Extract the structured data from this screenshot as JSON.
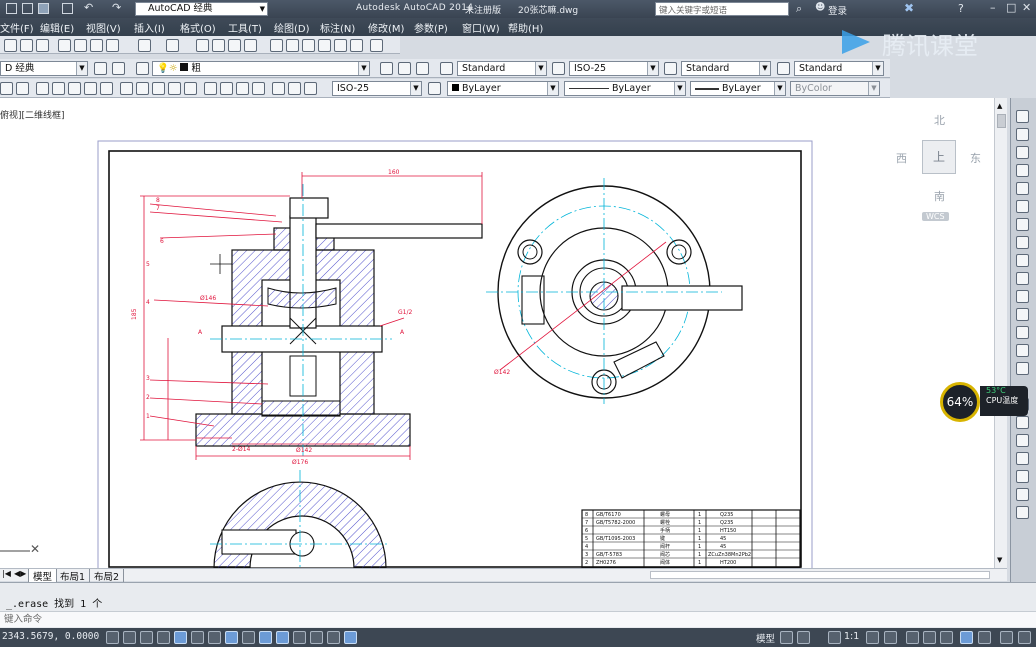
{
  "titlebar": {
    "workspace_combo": "AutoCAD 经典",
    "app_title": "Autodesk AutoCAD 2014",
    "document_title": "未注册版",
    "file_name": "20张芯嘛.dwg",
    "search_placeholder": "键入关键字或短语",
    "login_label": "登录"
  },
  "menubar": {
    "items": [
      "文件(F)",
      "编辑(E)",
      "视图(V)",
      "插入(I)",
      "格式(O)",
      "工具(T)",
      "绘图(D)",
      "标注(N)",
      "修改(M)",
      "参数(P)",
      "窗口(W)",
      "帮助(H)"
    ]
  },
  "watermark": {
    "text": "腾讯课堂"
  },
  "styles_toolbar": {
    "workspace": "D 经典",
    "text_style": "Standard",
    "dim_style": "ISO-25",
    "table_style": "Standard",
    "multileader_style": "Standard"
  },
  "properties_toolbar": {
    "dim_style": "ISO-25",
    "color": "ByLayer",
    "linetype": "ByLayer",
    "lineweight": "ByLayer",
    "plotstyle": "ByColor"
  },
  "viewport_label": "俯视][二维线框]",
  "viewcube": {
    "north": "北",
    "south": "南",
    "east": "东",
    "west": "西",
    "top": "上",
    "wcs": "WCS"
  },
  "drawing": {
    "dim_top": "160",
    "dim_left_height": "185",
    "dim_width_bottom": "Ø176",
    "dim_inner": "Ø142",
    "dim_base": "Ø146",
    "dim_small": "2-Ø14",
    "thread_label": "G1/2",
    "callouts": [
      "8",
      "7",
      "6",
      "5",
      "4",
      "3",
      "2",
      "1"
    ],
    "section_label_a": "A",
    "circle_dim": "Ø142"
  },
  "title_block": {
    "rows": [
      [
        "8",
        "GB/T6170",
        "螺母",
        "1",
        "Q235"
      ],
      [
        "7",
        "GB/T5782-2000",
        "螺栓",
        "1",
        "Q235"
      ],
      [
        "6",
        "",
        "手柄",
        "1",
        "HT150"
      ],
      [
        "5",
        "GB/T1095-2003",
        "键",
        "1",
        "45"
      ],
      [
        "4",
        "",
        "阀杆",
        "1",
        "45"
      ],
      [
        "3",
        "GB/T-5783",
        "阀芯",
        "1",
        "ZCuZn38Mn2Pb2"
      ],
      [
        "2",
        "ZH0276",
        "阀体",
        "1",
        "HT200"
      ]
    ]
  },
  "tabs": {
    "model": "模型",
    "layout1": "布局1",
    "layout2": "布局2"
  },
  "command": {
    "history": "_.erase 找到 1 个",
    "prompt": "键入命令"
  },
  "status": {
    "coords": "2343.5679, 0.0000",
    "model_label": "模型",
    "scale": "1:1"
  },
  "cpu_widget": {
    "percent": "64%",
    "temp": "53°C",
    "label": "CPU温度"
  },
  "colors": {
    "dim_red": "#e0143c",
    "center_cyan": "#00b4d8",
    "hatch_blue": "#3a3ad0",
    "object_black": "#111111"
  }
}
